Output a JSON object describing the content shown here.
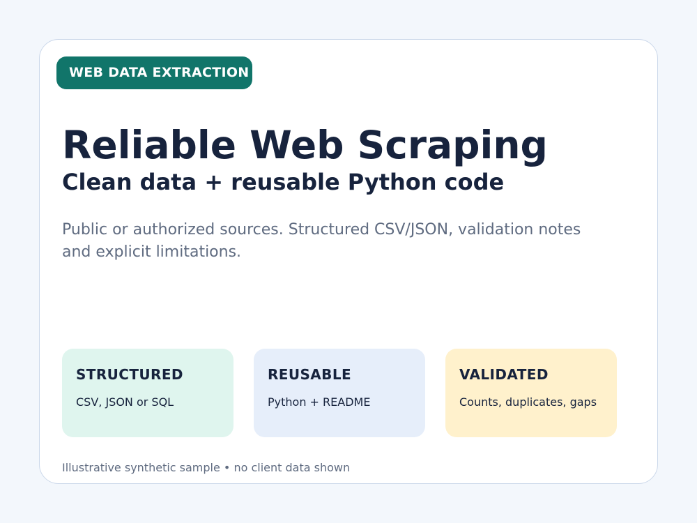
{
  "badge": {
    "label": "WEB DATA EXTRACTION"
  },
  "hero": {
    "title": "Reliable Web Scraping",
    "subtitle": "Clean data + reusable Python code",
    "description": "Public or authorized sources. Structured CSV/JSON, validation notes and explicit limitations."
  },
  "features": [
    {
      "title": "STRUCTURED",
      "text": "CSV, JSON or SQL"
    },
    {
      "title": "REUSABLE",
      "text": "Python + README"
    },
    {
      "title": "VALIDATED",
      "text": "Counts, duplicates, gaps"
    }
  ],
  "footer": {
    "note": "Illustrative synthetic sample • no client data shown"
  },
  "colors": {
    "page_background": "#f3f7fc",
    "card_background": "#ffffff",
    "badge_background": "#11756a",
    "heading_text": "#17233d",
    "muted_text": "#5f6b80",
    "feature_structured_bg": "#dff5ee",
    "feature_reusable_bg": "#e6eefa",
    "feature_validated_bg": "#fff1cc"
  }
}
